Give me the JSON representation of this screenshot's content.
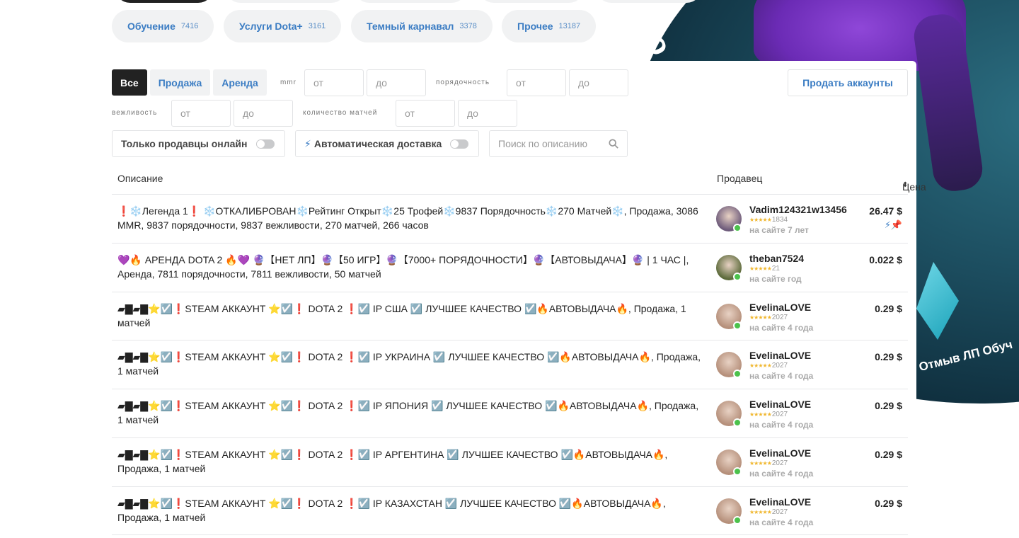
{
  "categories_top": [
    "",
    "",
    "",
    "",
    ""
  ],
  "categories": [
    {
      "label": "Обучение",
      "count": "7416"
    },
    {
      "label": "Услуги Dota+",
      "count": "3161"
    },
    {
      "label": "Темный карнавал",
      "count": "3378"
    },
    {
      "label": "Прочее",
      "count": "13187"
    }
  ],
  "filters": {
    "type_all": "Все",
    "type_sale": "Продажа",
    "type_rent": "Аренда",
    "mmr_label": "mmr",
    "decency_label": "порядочность",
    "politeness_label": "вежливость",
    "matches_label": "количество матчей",
    "from_placeholder": "от",
    "to_placeholder": "до",
    "sell_button": "Продать аккаунты",
    "online_only": "Только продавцы онлайн",
    "auto_delivery": "Автоматическая доставка",
    "search_placeholder": "Поиск по описанию"
  },
  "banner": {
    "logo_word": "Do",
    "ring_text": "Отмыв ЛП  Обуч"
  },
  "table": {
    "col_description": "Описание",
    "col_seller": "Продавец",
    "col_price": "Цена",
    "rows": [
      {
        "description": "❗❄️Легенда 1❗ ❄️ОТКАЛИБРОВАН❄️Рейтинг Открыт❄️25 Трофей❄️9837 Порядочность❄️270 Матчей❄️, Продажа, 3086 MMR, 9837 порядочности, 9837 вежливости, 270 матчей, 266 часов",
        "seller": "Vadim124321w13456",
        "reviews": "1834",
        "since": "на сайте 7 лет",
        "price": "26.47 $",
        "auto": true,
        "pinned": true,
        "avatar": "#6d5a7a"
      },
      {
        "description": "💜🔥 АРЕНДА DOTA 2 🔥💜 🔮【НЕТ ЛП】🔮【50 ИГР】🔮【7000+ ПОРЯДОЧНОСТИ】🔮【АВТОВЫДАЧА】🔮 | 1 ЧАС |, Аренда, 7811 порядочности, 7811 вежливости, 50 матчей",
        "seller": "theban7524",
        "reviews": "21",
        "since": "на сайте год",
        "price": "0.022 $",
        "auto": false,
        "pinned": false,
        "avatar": "#5c6a3a"
      },
      {
        "description": "▰▇▰▇⭐☑️❗STEAM АККАУНТ ⭐☑️❗ DOTA 2 ❗☑️ IP США ☑️ ЛУЧШЕЕ КАЧЕСТВО ☑️🔥АВТОВЫДАЧА🔥, Продажа, 1 матчей",
        "seller": "EvelinaLOVE",
        "reviews": "2027",
        "since": "на сайте 4 года",
        "price": "0.29 $",
        "auto": false,
        "pinned": false,
        "avatar": "#b58f7a"
      },
      {
        "description": "▰▇▰▇⭐☑️❗STEAM АККАУНТ ⭐☑️❗ DOTA 2 ❗☑️ IP УКРАИНА ☑️ ЛУЧШЕЕ КАЧЕСТВО ☑️🔥АВТОВЫДАЧА🔥, Продажа, 1 матчей",
        "seller": "EvelinaLOVE",
        "reviews": "2027",
        "since": "на сайте 4 года",
        "price": "0.29 $",
        "auto": false,
        "pinned": false,
        "avatar": "#b58f7a"
      },
      {
        "description": "▰▇▰▇⭐☑️❗STEAM АККАУНТ ⭐☑️❗ DOTA 2 ❗☑️ IP ЯПОНИЯ ☑️ ЛУЧШЕЕ КАЧЕСТВО ☑️🔥АВТОВЫДАЧА🔥, Продажа, 1 матчей",
        "seller": "EvelinaLOVE",
        "reviews": "2027",
        "since": "на сайте 4 года",
        "price": "0.29 $",
        "auto": false,
        "pinned": false,
        "avatar": "#b58f7a"
      },
      {
        "description": "▰▇▰▇⭐☑️❗STEAM АККАУНТ ⭐☑️❗ DOTA 2 ❗☑️ IP АРГЕНТИНА ☑️ ЛУЧШЕЕ КАЧЕСТВО ☑️🔥АВТОВЫДАЧА🔥, Продажа, 1 матчей",
        "seller": "EvelinaLOVE",
        "reviews": "2027",
        "since": "на сайте 4 года",
        "price": "0.29 $",
        "auto": false,
        "pinned": false,
        "avatar": "#b58f7a"
      },
      {
        "description": "▰▇▰▇⭐☑️❗STEAM АККАУНТ ⭐☑️❗ DOTA 2 ❗☑️ IP КАЗАХСТАН ☑️ ЛУЧШЕЕ КАЧЕСТВО ☑️🔥АВТОВЫДАЧА🔥, Продажа, 1 матчей",
        "seller": "EvelinaLOVE",
        "reviews": "2027",
        "since": "на сайте 4 года",
        "price": "0.29 $",
        "auto": false,
        "pinned": false,
        "avatar": "#b58f7a"
      }
    ]
  },
  "colors": {
    "accent": "#3a7cc3",
    "dark": "#222222",
    "online": "#4cc24c",
    "star": "#f0b72f"
  }
}
